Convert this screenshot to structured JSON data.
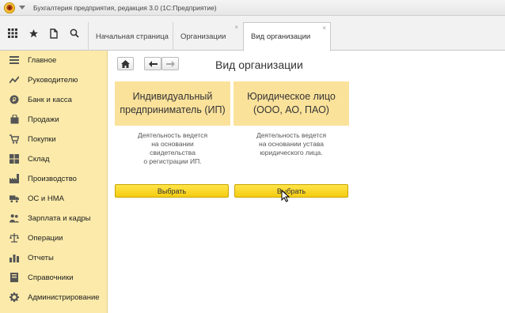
{
  "window": {
    "title": "Бухгалтерия предприятия, редакция 3.0  (1С:Предприятие)"
  },
  "tabs": [
    {
      "label": "Начальная страница",
      "closable": false
    },
    {
      "label": "Организации",
      "closable": true
    },
    {
      "label": "Вид организации",
      "closable": true,
      "active": true
    }
  ],
  "tab_close_glyph": "×",
  "sidebar": {
    "items": [
      {
        "label": "Главное",
        "icon": "menu-list-icon"
      },
      {
        "label": "Руководителю",
        "icon": "trend-line-icon"
      },
      {
        "label": "Банк и касса",
        "icon": "coin-icon"
      },
      {
        "label": "Продажи",
        "icon": "shopping-bag-icon"
      },
      {
        "label": "Покупки",
        "icon": "cart-icon"
      },
      {
        "label": "Склад",
        "icon": "warehouse-icon"
      },
      {
        "label": "Производство",
        "icon": "factory-icon"
      },
      {
        "label": "ОС и НМА",
        "icon": "truck-icon"
      },
      {
        "label": "Зарплата и кадры",
        "icon": "people-icon"
      },
      {
        "label": "Операции",
        "icon": "scales-icon"
      },
      {
        "label": "Отчеты",
        "icon": "bar-chart-icon"
      },
      {
        "label": "Справочники",
        "icon": "book-icon"
      },
      {
        "label": "Администрирование",
        "icon": "gear-icon"
      }
    ]
  },
  "page": {
    "title": "Вид организации"
  },
  "cards": [
    {
      "heading": "Индивидуальный предприниматель (ИП)",
      "desc_lines": [
        "Деятельность ведется",
        "на основании",
        "свидетельства",
        "о регистрации ИП."
      ],
      "button": "Выбрать"
    },
    {
      "heading": "Юридическое лицо (ООО, АО, ПАО)",
      "desc_lines": [
        "Деятельность ведется",
        "на основании устава",
        "юридического лица."
      ],
      "button": "Выбрать"
    }
  ],
  "colors": {
    "sidebar_bg": "#fbeaa9",
    "card_header_bg": "#fbe29b",
    "button_bg": "#f5cc10"
  }
}
